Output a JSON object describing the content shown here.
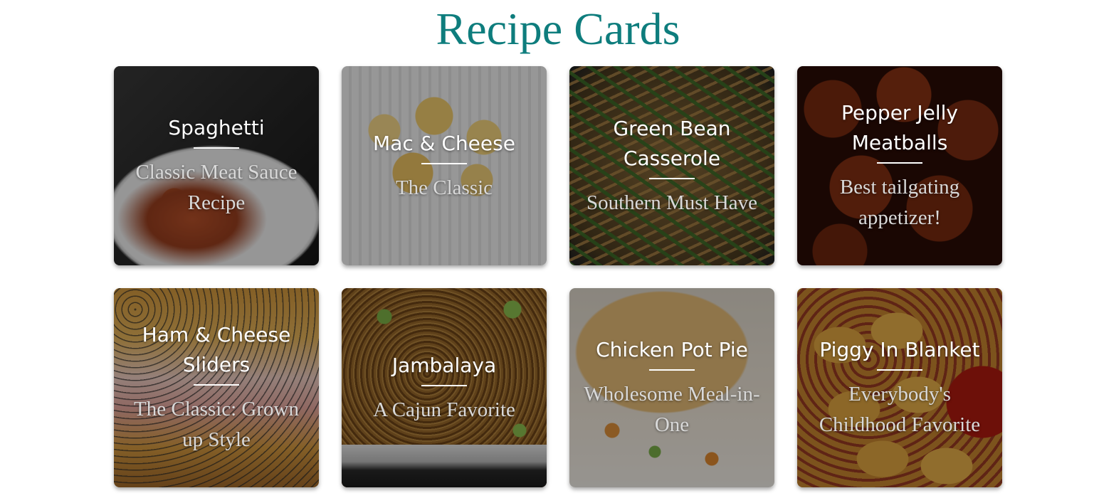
{
  "page": {
    "title": "Recipe Cards",
    "title_color": "#0e7d7d"
  },
  "cards": [
    {
      "title": "Spaghetti",
      "subtitle": "Classic Meat Sauce Recipe"
    },
    {
      "title": "Mac & Cheese",
      "subtitle": "The Classic"
    },
    {
      "title": "Green Bean Casserole",
      "subtitle": "Southern Must Have"
    },
    {
      "title": "Pepper Jelly Meatballs",
      "subtitle": "Best tailgating appetizer!"
    },
    {
      "title": "Ham & Cheese Sliders",
      "subtitle": "The Classic: Grown up Style"
    },
    {
      "title": "Jambalaya",
      "subtitle": "A Cajun Favorite"
    },
    {
      "title": "Chicken Pot Pie",
      "subtitle": "Wholesome Meal-in-One"
    },
    {
      "title": "Piggy In Blanket",
      "subtitle": "Everybody's Childhood Favorite"
    }
  ]
}
